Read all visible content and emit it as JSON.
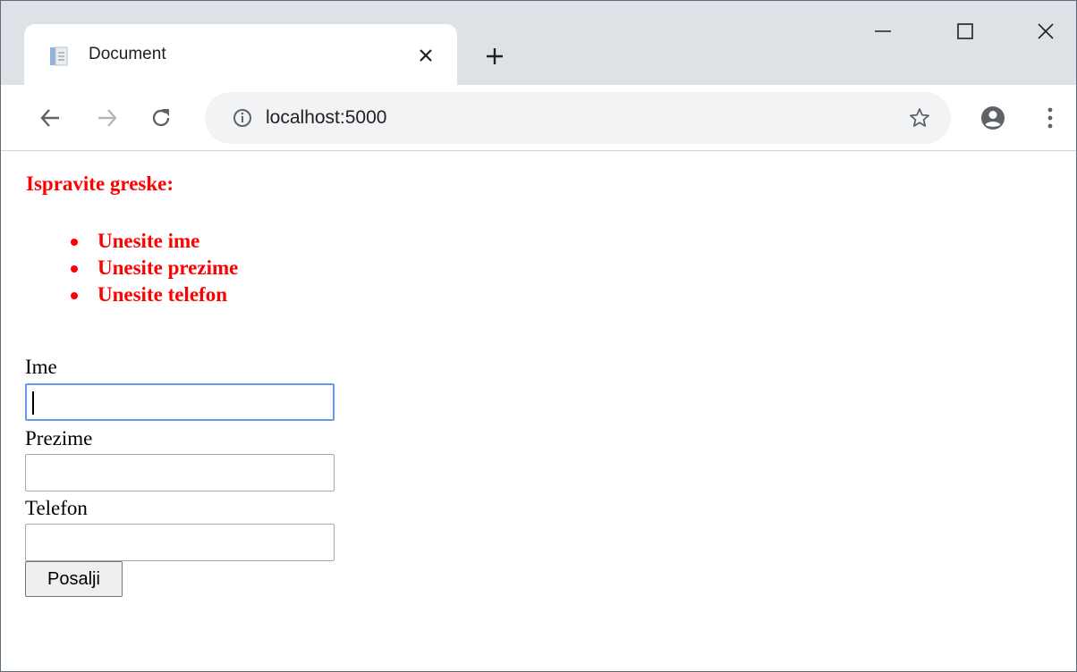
{
  "browser": {
    "tab_title": "Document",
    "url": "localhost:5000",
    "tab_favicon": "document-icon",
    "tab_close_icon": "close-icon",
    "new_tab_icon": "plus-icon",
    "nav": {
      "back_icon": "arrow-left-icon",
      "forward_icon": "arrow-right-icon",
      "reload_icon": "reload-icon",
      "info_icon": "info-icon",
      "bookmark_icon": "star-icon",
      "profile_icon": "account-icon",
      "menu_icon": "kebab-menu-icon"
    },
    "window_controls": [
      "minimize-icon",
      "maximize-icon",
      "close-window-icon"
    ]
  },
  "page": {
    "errors": {
      "title": "Ispravite greske:",
      "color": "#ff0000",
      "items": [
        "Unesite ime",
        "Unesite prezime",
        "Unesite telefon"
      ]
    },
    "form": {
      "fields": [
        {
          "label": "Ime",
          "value": "",
          "focused": true
        },
        {
          "label": "Prezime",
          "value": "",
          "focused": false
        },
        {
          "label": "Telefon",
          "value": "",
          "focused": false
        }
      ],
      "submit_label": "Posalji"
    }
  }
}
